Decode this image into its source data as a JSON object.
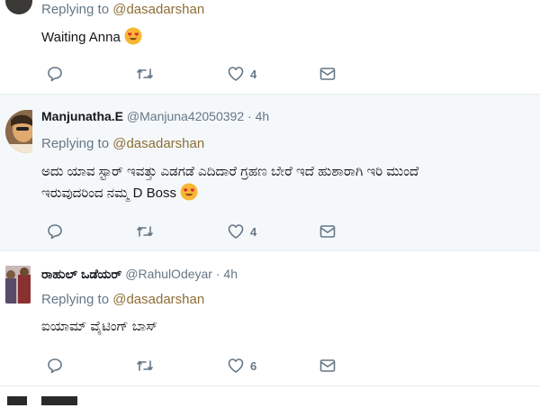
{
  "tweets": [
    {
      "reply_prefix": "Replying to",
      "reply_to": "@dasadarshan",
      "text": "Waiting Anna",
      "emoji": "heart-eyes",
      "likes": "4"
    },
    {
      "name": "Manjunatha.E",
      "handle": "@Manjuna42050392",
      "dot": "·",
      "time": "4h",
      "reply_prefix": "Replying to",
      "reply_to": "@dasadarshan",
      "text_line1": "ಅದು ಯಾವ ಸ್ಟಾರ್ ಇವತ್ತು ಎಡಗಡೆ ಎದಿದಾರೆ ಗ್ರಹಣ ಬೇರೆ ಇದೆ ಹುಶಾರಾಗಿ ಇರಿ ಮುಂದೆ",
      "text_line2": "ಇರುವುದರಿಂದ ನಮ್ಮ D Boss",
      "emoji": "heart-eyes",
      "likes": "4"
    },
    {
      "name": "ರಾಹುಲ್ ಒಡೆಯರ್",
      "handle": "@RahulOdeyar",
      "dot": "·",
      "time": "4h",
      "reply_prefix": "Replying to",
      "reply_to": "@dasadarshan",
      "text": "ಐಯಾಮ್ ವೈಟಿಂಗ್ ಬಾಸ್",
      "likes": "6"
    }
  ],
  "colors": {
    "mention": "#8d6e37",
    "muted": "#657786",
    "highlight_bg": "#f5f8fa",
    "divider": "#e6ecf0"
  }
}
